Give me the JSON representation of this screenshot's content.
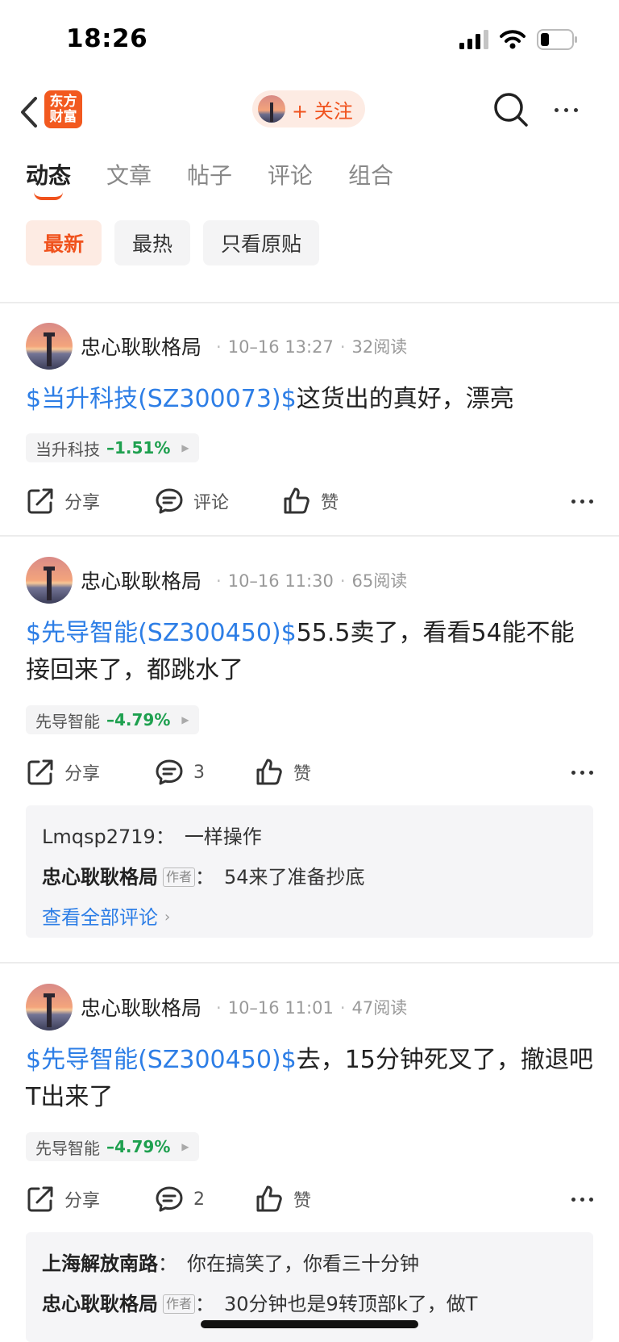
{
  "status_bar": {
    "time": "18:26"
  },
  "nav": {
    "logo_text_line1": "东方",
    "logo_text_line2": "财富",
    "follow_label": "+ 关注"
  },
  "tabs": [
    {
      "label": "动态",
      "active": true
    },
    {
      "label": "文章",
      "active": false
    },
    {
      "label": "帖子",
      "active": false
    },
    {
      "label": "评论",
      "active": false
    },
    {
      "label": "组合",
      "active": false
    }
  ],
  "filters": [
    {
      "label": "最新",
      "active": true
    },
    {
      "label": "最热",
      "active": false
    },
    {
      "label": "只看原贴",
      "active": false
    }
  ],
  "posts": [
    {
      "author": "忠心耿耿格局",
      "date": "10–16 13:27",
      "reads": "32阅读",
      "stock_link": "$当升科技(SZ300073)$",
      "text": "这货出的真好，漂亮",
      "tag_name": "当升科技",
      "tag_change": "–1.51%",
      "share_label": "分享",
      "comment_label": "评论",
      "like_label": "赞"
    },
    {
      "author": "忠心耿耿格局",
      "date": "10–16 11:30",
      "reads": "65阅读",
      "stock_link": "$先导智能(SZ300450)$",
      "text": "55.5卖了，看看54能不能接回来了，都跳水了",
      "tag_name": "先导智能",
      "tag_change": "–4.79%",
      "share_label": "分享",
      "comment_label": "3",
      "like_label": "赞",
      "comments": [
        {
          "user": "Lmqsp2719",
          "is_author": false,
          "text": "一样操作"
        },
        {
          "user": "忠心耿耿格局",
          "is_author": true,
          "text": "54来了准备抄底"
        }
      ],
      "view_all": "查看全部评论"
    },
    {
      "author": "忠心耿耿格局",
      "date": "10–16 11:01",
      "reads": "47阅读",
      "stock_link": "$先导智能(SZ300450)$",
      "text": "去，15分钟死叉了，撤退吧T出来了",
      "tag_name": "先导智能",
      "tag_change": "–4.79%",
      "share_label": "分享",
      "comment_label": "2",
      "like_label": "赞",
      "comments": [
        {
          "user": "上海解放南路",
          "is_author": false,
          "text": "你在搞笑了，你看三十分钟"
        },
        {
          "user": "忠心耿耿格局",
          "is_author": true,
          "text": "30分钟也是9转顶部k了，做T"
        }
      ]
    }
  ],
  "author_badge": "作者",
  "colors": {
    "accent": "#f0521d",
    "link": "#2d7ee6",
    "down": "#1ea04f"
  }
}
